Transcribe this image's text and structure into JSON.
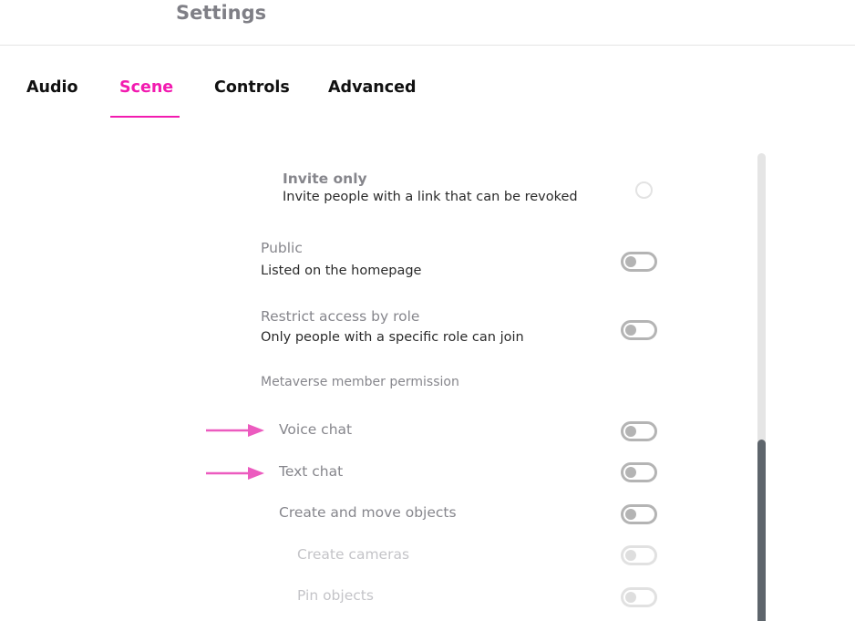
{
  "header": {
    "title": "Settings"
  },
  "tabs": [
    {
      "label": "Audio",
      "active": false
    },
    {
      "label": "Scene",
      "active": true
    },
    {
      "label": "Controls",
      "active": false
    },
    {
      "label": "Advanced",
      "active": false
    }
  ],
  "colors": {
    "accent": "#f21bb0",
    "annotation_arrow": "#ec5bbf",
    "scrollbar_thumb": "#5e656c",
    "scrollbar_track": "#e5e5e5"
  },
  "settings": {
    "invite_only": {
      "title": "Invite only",
      "description": "Invite people with a link that can be revoked",
      "control": "radio",
      "selected": false
    },
    "public": {
      "title": "Public",
      "description": "Listed on the homepage",
      "control": "toggle",
      "enabled": false
    },
    "restrict_by_role": {
      "title": "Restrict access by role",
      "description": "Only people with a specific role can join",
      "control": "toggle",
      "enabled": false
    },
    "member_permission_label": "Metaverse member permission",
    "permissions": [
      {
        "title": "Voice chat",
        "enabled": false,
        "disabled": false,
        "annotated": true
      },
      {
        "title": "Text chat",
        "enabled": false,
        "disabled": false,
        "annotated": true
      },
      {
        "title": "Create and move objects",
        "enabled": false,
        "disabled": false,
        "annotated": false
      },
      {
        "title": "Create cameras",
        "enabled": false,
        "disabled": true,
        "annotated": false
      },
      {
        "title": "Pin objects",
        "enabled": false,
        "disabled": true,
        "annotated": false
      }
    ]
  },
  "icons": {
    "annotation_arrow": "right-arrow",
    "radio": "radio-unchecked",
    "toggle": "switch-off"
  }
}
